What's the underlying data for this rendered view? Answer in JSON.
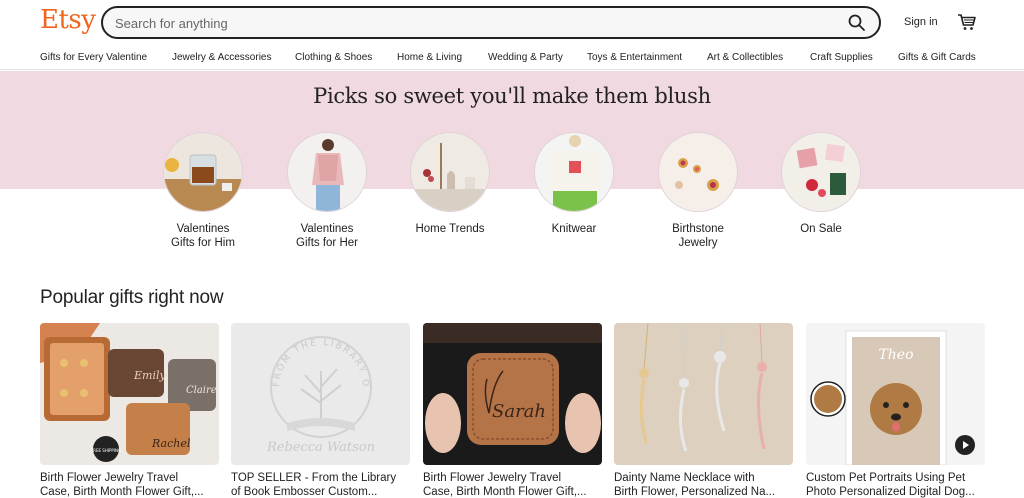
{
  "header": {
    "logo": "Etsy",
    "search_placeholder": "Search for anything",
    "signin_label": "Sign in"
  },
  "nav": {
    "items": [
      "Gifts for Every Valentine",
      "Jewelry & Accessories",
      "Clothing & Shoes",
      "Home & Living",
      "Wedding & Party",
      "Toys & Entertainment",
      "Art & Collectibles",
      "Craft Supplies",
      "Gifts & Gift Cards"
    ]
  },
  "banner": {
    "title": "Picks so sweet you'll make them blush"
  },
  "categories": [
    {
      "line1": "Valentines",
      "line2": "Gifts for Him"
    },
    {
      "line1": "Valentines",
      "line2": "Gifts for Her"
    },
    {
      "line1": "Home Trends",
      "line2": ""
    },
    {
      "line1": "Knitwear",
      "line2": ""
    },
    {
      "line1": "Birthstone",
      "line2": "Jewelry"
    },
    {
      "line1": "On Sale",
      "line2": ""
    }
  ],
  "popular": {
    "title": "Popular gifts right now",
    "items": [
      {
        "line1": "Birth Flower Jewelry Travel",
        "line2": "Case, Birth Month Flower Gift,..."
      },
      {
        "line1": "TOP SELLER - From the Library",
        "line2": "of Book Embosser Custom..."
      },
      {
        "line1": "Birth Flower Jewelry Travel",
        "line2": "Case, Birth Month Flower Gift,..."
      },
      {
        "line1": "Dainty Name Necklace with",
        "line2": "Birth Flower, Personalized Na..."
      },
      {
        "line1": "Custom Pet Portraits Using Pet",
        "line2": "Photo Personalized Digital Dog..."
      }
    ],
    "image_text": {
      "case_names": [
        "Emily",
        "Claire",
        "Rachel"
      ],
      "free_shipping": "FREE SHIPPING",
      "embosser_arc": "FROM THE LIBRARY OF",
      "embosser_name": "Rebecca Watson",
      "case_name": "Sarah",
      "pet_name": "Theo"
    }
  },
  "colors": {
    "brand": "#f1641e",
    "banner_bg": "#f0d9e1"
  }
}
